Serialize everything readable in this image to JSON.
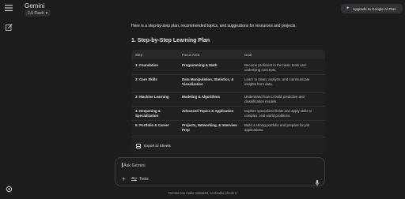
{
  "app": {
    "title": "Gemini",
    "model": "2.5 Flash",
    "upgrade_label": "Upgrade to Google AI Plus"
  },
  "icons": {
    "menu": "menu-icon",
    "edit": "edit-icon",
    "settings": "gear-icon",
    "spark": "sparkle-icon",
    "sheet": "sheets-icon",
    "plus": "plus-icon",
    "tools": "tools-icon",
    "mic": "mic-icon"
  },
  "message": {
    "intro": "Here is a step-by-step plan, recommended topics, and suggestions for resources and projects.",
    "section_heading": "1. Step-by-Step Learning Plan",
    "table": {
      "headers": [
        "Step",
        "Focus Area",
        "Goal"
      ],
      "rows": [
        {
          "step": "1: Foundation",
          "focus": "Programming & Math",
          "goal": "Become proficient in the basic tools and underlying concepts."
        },
        {
          "step": "2: Core Skills",
          "focus": "Data Manipulation, Statistics, & Visualization",
          "goal": "Learn to clean, analyze, and communicate insights from data."
        },
        {
          "step": "3: Machine Learning",
          "focus": "Modeling & Algorithms",
          "goal": "Understand how to build predictive and classification models."
        },
        {
          "step": "4: Deepening & Specialization",
          "focus": "Advanced Topics & Application",
          "goal": "Explore specialized fields and apply skills to complex, real-world problems."
        },
        {
          "step": "5: Portfolio & Career",
          "focus": "Projects, Networking, & Interview Prep",
          "goal": "Build a strong portfolio and prepare for job applications."
        }
      ]
    },
    "export_label": "Export to Sheets"
  },
  "composer": {
    "placeholder": "Ask Gemini",
    "tools_label": "Tools"
  },
  "disclaimer": "Gemini can make mistakes, so double-check it"
}
